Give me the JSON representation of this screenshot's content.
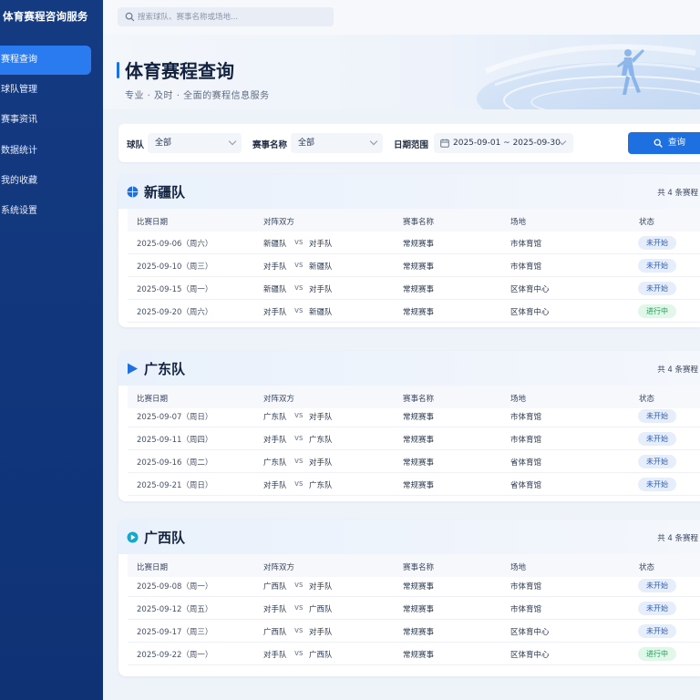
{
  "app": {
    "title": "体育赛程咨询服务"
  },
  "sidebar": {
    "items": [
      {
        "label": "赛程查询",
        "active": true
      },
      {
        "label": "球队管理",
        "active": false
      },
      {
        "label": "赛事资讯",
        "active": false
      },
      {
        "label": "数据统计",
        "active": false
      },
      {
        "label": "我的收藏",
        "active": false
      },
      {
        "label": "系统设置",
        "active": false
      }
    ]
  },
  "search": {
    "placeholder": "搜索球队、赛事名称或场地..."
  },
  "hero": {
    "title": "体育赛程查询",
    "subtitle": "专业 · 及时 · 全面的赛程信息服务"
  },
  "filter": {
    "team_label": "球队",
    "team_value": "全部",
    "event_label": "赛事名称",
    "event_value": "全部",
    "date_label": "日期范围",
    "date_value": "2025-09-01 ~ 2025-09-30",
    "query_label": "查询"
  },
  "table_columns": [
    "比赛日期",
    "对阵双方",
    "赛事名称",
    "场地",
    "状态"
  ],
  "teams": [
    {
      "name": "新疆队",
      "count": "共 4 条赛程",
      "icon": "basketball-icon",
      "accent": "#1e6fe0",
      "rows": [
        {
          "date": "2025-09-06（周六）",
          "home": "新疆队",
          "vs": "vs",
          "away": "对手队",
          "event": "常规赛事",
          "venue": "市体育馆",
          "status": "未开始",
          "status_type": "pending"
        },
        {
          "date": "2025-09-10（周三）",
          "home": "对手队",
          "vs": "vs",
          "away": "新疆队",
          "event": "常规赛事",
          "venue": "市体育馆",
          "status": "未开始",
          "status_type": "pending"
        },
        {
          "date": "2025-09-15（周一）",
          "home": "新疆队",
          "vs": "vs",
          "away": "对手队",
          "event": "常规赛事",
          "venue": "区体育中心",
          "status": "未开始",
          "status_type": "pending"
        },
        {
          "date": "2025-09-20（周六）",
          "home": "对手队",
          "vs": "vs",
          "away": "新疆队",
          "event": "常规赛事",
          "venue": "区体育中心",
          "status": "进行中",
          "status_type": "live"
        }
      ]
    },
    {
      "name": "广东队",
      "count": "共 4 条赛程",
      "icon": "flag-icon",
      "accent": "#1e6fe0",
      "rows": [
        {
          "date": "2025-09-07（周日）",
          "home": "广东队",
          "vs": "vs",
          "away": "对手队",
          "event": "常规赛事",
          "venue": "市体育馆",
          "status": "未开始",
          "status_type": "pending"
        },
        {
          "date": "2025-09-11（周四）",
          "home": "对手队",
          "vs": "vs",
          "away": "广东队",
          "event": "常规赛事",
          "venue": "市体育馆",
          "status": "未开始",
          "status_type": "pending"
        },
        {
          "date": "2025-09-16（周二）",
          "home": "广东队",
          "vs": "vs",
          "away": "对手队",
          "event": "常规赛事",
          "venue": "省体育馆",
          "status": "未开始",
          "status_type": "pending"
        },
        {
          "date": "2025-09-21（周日）",
          "home": "对手队",
          "vs": "vs",
          "away": "广东队",
          "event": "常规赛事",
          "venue": "省体育馆",
          "status": "未开始",
          "status_type": "pending"
        }
      ]
    },
    {
      "name": "广西队",
      "count": "共 4 条赛程",
      "icon": "play-icon",
      "accent": "#17a7c8",
      "rows": [
        {
          "date": "2025-09-08（周一）",
          "home": "广西队",
          "vs": "vs",
          "away": "对手队",
          "event": "常规赛事",
          "venue": "市体育馆",
          "status": "未开始",
          "status_type": "pending"
        },
        {
          "date": "2025-09-12（周五）",
          "home": "对手队",
          "vs": "vs",
          "away": "广西队",
          "event": "常规赛事",
          "venue": "市体育馆",
          "status": "未开始",
          "status_type": "pending"
        },
        {
          "date": "2025-09-17（周三）",
          "home": "广西队",
          "vs": "vs",
          "away": "对手队",
          "event": "常规赛事",
          "venue": "区体育中心",
          "status": "未开始",
          "status_type": "pending"
        },
        {
          "date": "2025-09-22（周一）",
          "home": "对手队",
          "vs": "vs",
          "away": "广西队",
          "event": "常规赛事",
          "venue": "区体育中心",
          "status": "进行中",
          "status_type": "live"
        }
      ]
    }
  ]
}
